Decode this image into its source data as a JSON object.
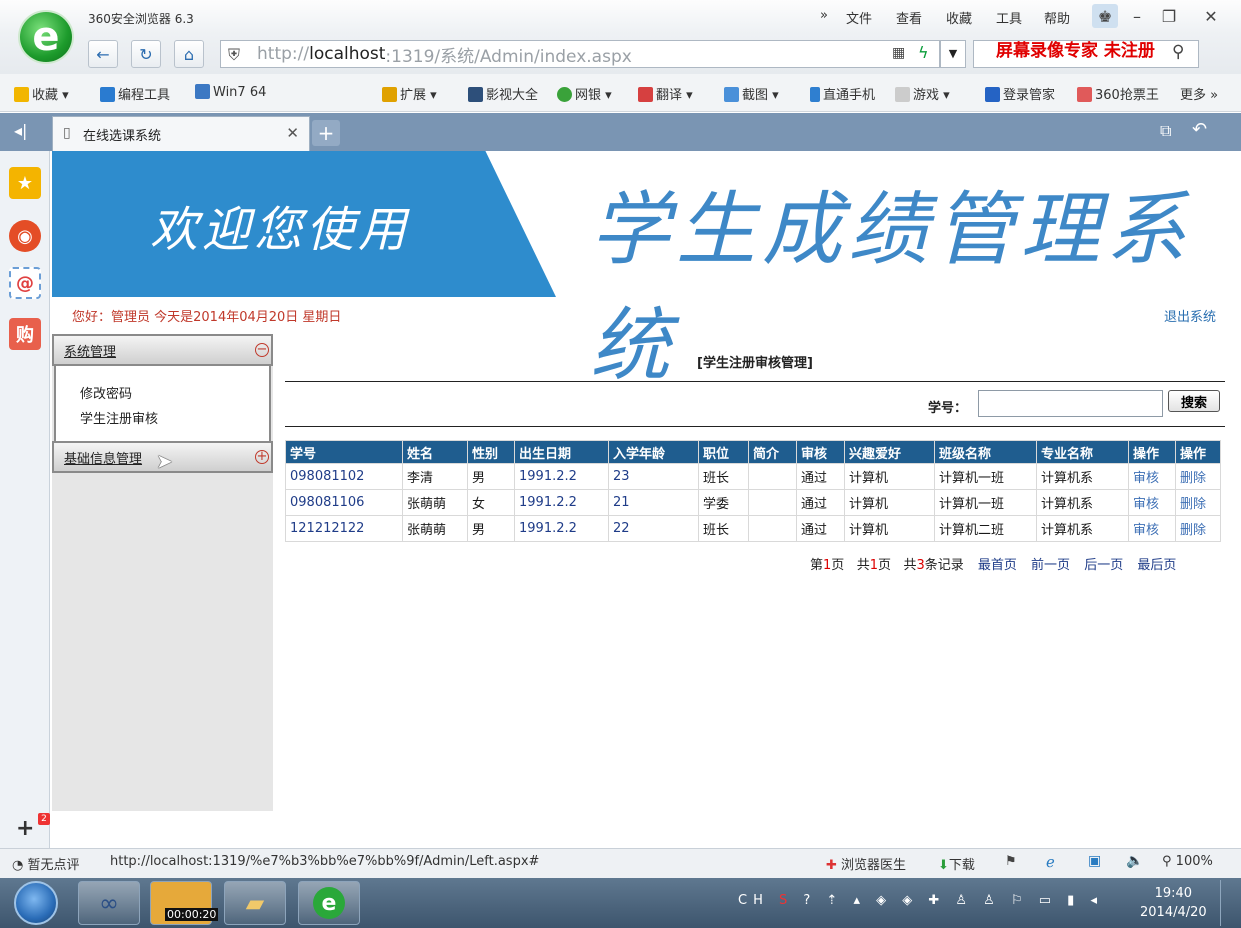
{
  "browser": {
    "title": "360安全浏览器 6.3",
    "menu": [
      "»",
      "文件",
      "查看",
      "收藏",
      "工具",
      "帮助"
    ],
    "url_prefix": "http://",
    "url_host": "localhost",
    "url_rest": ":1319/系统/Admin/index.aspx",
    "watermark": "屏幕录像专家 未注册",
    "favorites": [
      "收藏",
      "编程工具",
      "Win7 64",
      "扩展",
      "影视大全",
      "网银",
      "翻译",
      "截图",
      "直通手机",
      "游戏",
      "登录管家",
      "360抢票王",
      "更多 »"
    ],
    "tab_title": "在线选课系统",
    "status_left": "暂无点评",
    "status_url": "http://localhost:1319/%e7%b3%bb%e7%bb%9f/Admin/Left.aspx#",
    "status_right": [
      "浏览器医生",
      "下载",
      "100%"
    ]
  },
  "banner": {
    "welcome": "欢迎您使用",
    "system_name": "学生成绩管理系统"
  },
  "header": {
    "greeting": "您好：管理员   今天是2014年04月20日  星期日",
    "logout": "退出系统"
  },
  "nav": {
    "section1": "系统管理",
    "section1_items": [
      "修改密码",
      "学生注册审核"
    ],
    "section2": "基础信息管理"
  },
  "main": {
    "title": "[学生注册审核管理]",
    "search_label": "学号：",
    "search_button": "搜索",
    "columns": [
      "学号",
      "姓名",
      "性别",
      "出生日期",
      "入学年龄",
      "职位",
      "简介",
      "审核",
      "兴趣爱好",
      "班级名称",
      "专业名称",
      "操作",
      "操作"
    ],
    "rows": [
      [
        "098081102",
        "李清",
        "男",
        "1991.2.2",
        "23",
        "班长",
        "",
        "通过",
        "计算机",
        "计算机一班",
        "计算机系",
        "审核",
        "删除"
      ],
      [
        "098081106",
        "张萌萌",
        "女",
        "1991.2.2",
        "21",
        "学委",
        "",
        "通过",
        "计算机",
        "计算机一班",
        "计算机系",
        "审核",
        "删除"
      ],
      [
        "121212122",
        "张萌萌",
        "男",
        "1991.2.2",
        "22",
        "班长",
        "",
        "通过",
        "计算机",
        "计算机二班",
        "计算机系",
        "审核",
        "删除"
      ]
    ],
    "pager": {
      "page_pre": "第",
      "page": "1",
      "page_post": "页",
      "total_pre": "共",
      "total_pages": "1",
      "total_post": "页",
      "rec_pre": "共",
      "records": "3",
      "rec_post": "条记录",
      "first": "最首页",
      "prev": "前一页",
      "next": "后一页",
      "last": "最后页"
    }
  },
  "taskbar": {
    "recorder_time": "00:00:20",
    "tray_lang": "CH",
    "time": "19:40",
    "date": "2014/4/20"
  }
}
